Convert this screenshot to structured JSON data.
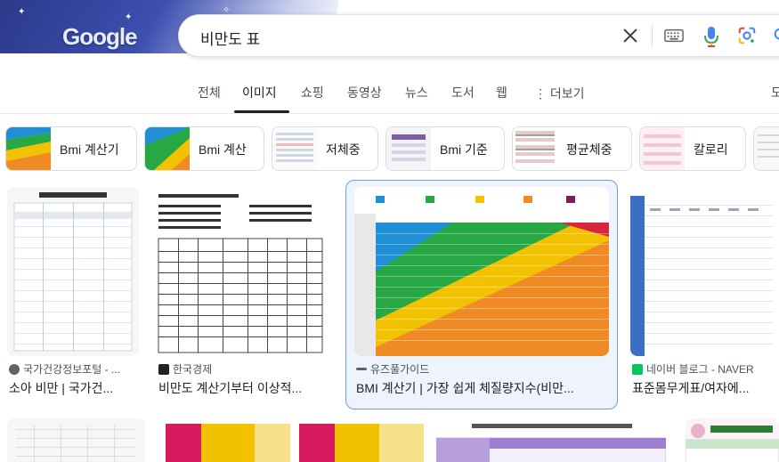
{
  "header": {
    "logo_text": "Google"
  },
  "search": {
    "query": "비만도 표"
  },
  "icons": {
    "clear": "close-icon",
    "keyboard": "keyboard-icon",
    "mic": "microphone-icon",
    "lens": "camera-lens-icon",
    "search": "search-icon"
  },
  "tabs": [
    {
      "label": "전체"
    },
    {
      "label": "이미지",
      "active": true
    },
    {
      "label": "쇼핑"
    },
    {
      "label": "동영상"
    },
    {
      "label": "뉴스"
    },
    {
      "label": "도서"
    },
    {
      "label": "웹"
    }
  ],
  "more": {
    "dots": "⋮",
    "label": "더보기"
  },
  "tab_right_fragment": "도",
  "chips": [
    {
      "label": "Bmi 계산기"
    },
    {
      "label": "Bmi 계산"
    },
    {
      "label": "저체중"
    },
    {
      "label": "Bmi 기준"
    },
    {
      "label": "평균체중"
    },
    {
      "label": "칼로리"
    }
  ],
  "results": [
    {
      "source": "국가건강정보포털 - ...",
      "title": "소아 비만 | 국가건...",
      "accent": "#5f6368"
    },
    {
      "source": "한국경제",
      "title": "비만도 계산기부터 이상적...",
      "accent": "#202124"
    },
    {
      "source": "유즈풀가이드",
      "title": "BMI 계산기 | 가장 쉽게 체질량지수(비만...",
      "accent": "#5f6368"
    },
    {
      "source": "네이버 블로그 - NAVER",
      "title": "표준몸무게표/여자에...",
      "accent": "#03c75a"
    }
  ],
  "colors": {
    "bmi_blue": "#1f8fd6",
    "bmi_green": "#28a745",
    "bmi_yellow": "#f2c200",
    "bmi_orange": "#f08a24",
    "bmi_red": "#d7263d",
    "selected_border": "#6c9ee5"
  }
}
